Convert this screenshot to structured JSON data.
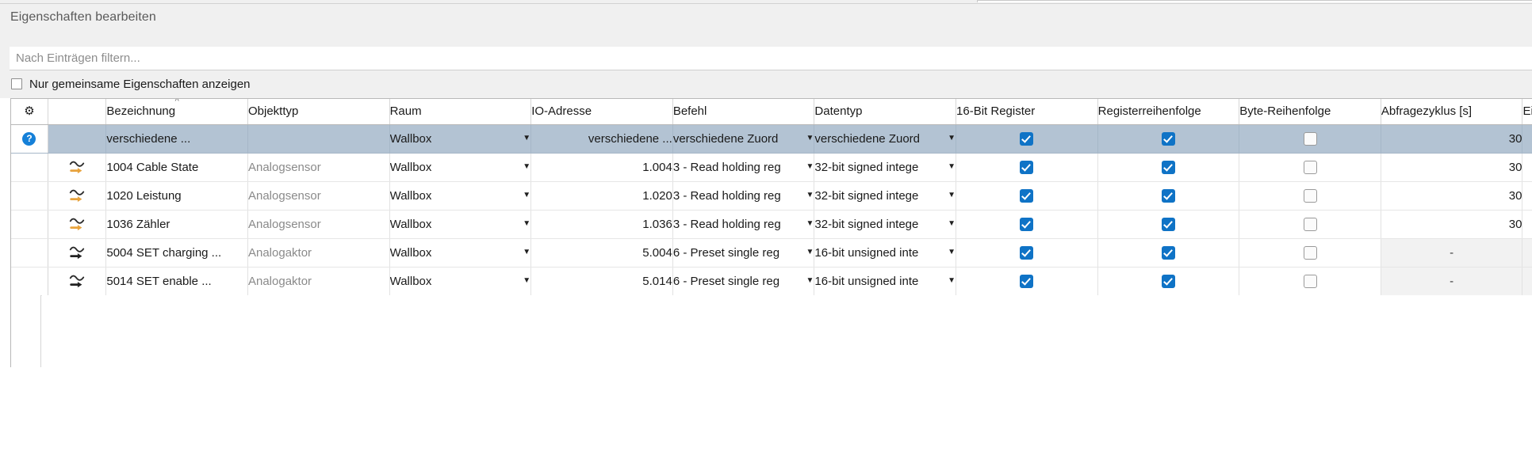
{
  "dialog": {
    "title": "Eigenschaften bearbeiten"
  },
  "filter": {
    "placeholder": "Nach Einträgen filtern...",
    "value": ""
  },
  "options": {
    "common_properties_label": "Nur gemeinsame Eigenschaften anzeigen",
    "common_properties_checked": false
  },
  "table": {
    "settings_icon": "gear-icon",
    "sort_column": "Bezeichnung",
    "sort_direction": "ascending",
    "columns": [
      {
        "key": "settings",
        "label": "",
        "icon": "gear-icon"
      },
      {
        "key": "typeicon",
        "label": ""
      },
      {
        "key": "bezeichnung",
        "label": "Bezeichnung"
      },
      {
        "key": "objekttyp",
        "label": "Objekttyp"
      },
      {
        "key": "raum",
        "label": "Raum"
      },
      {
        "key": "ioadresse",
        "label": "IO-Adresse"
      },
      {
        "key": "befehl",
        "label": "Befehl"
      },
      {
        "key": "datentyp",
        "label": "Datentyp"
      },
      {
        "key": "reg16",
        "label": "16-Bit Register"
      },
      {
        "key": "regorder",
        "label": "Registerreihenfolge"
      },
      {
        "key": "byteorder",
        "label": "Byte-Reihenfolge"
      },
      {
        "key": "abfrage",
        "label": "Abfragezyklus [s]"
      },
      {
        "key": "einheit",
        "label": "Ei"
      }
    ],
    "rows": [
      {
        "selected": true,
        "first_icon": "help-icon",
        "type_icon": "",
        "bezeichnung": "verschiedene ...",
        "objekttyp": "",
        "raum": "Wallbox",
        "ioadresse": "verschiedene ...",
        "befehl": "verschiedene Zuord",
        "datentyp": "verschiedene Zuord",
        "reg16": true,
        "regorder": true,
        "byteorder": false,
        "abfrage": "30",
        "abfrage_disabled": false
      },
      {
        "selected": false,
        "first_icon": "",
        "type_icon": "analog-sensor-icon",
        "bezeichnung": "1004 Cable State",
        "objekttyp": "Analogsensor",
        "raum": "Wallbox",
        "ioadresse": "1.004",
        "befehl": "3 - Read holding reg",
        "datentyp": "32-bit signed intege",
        "reg16": true,
        "regorder": true,
        "byteorder": false,
        "abfrage": "30",
        "abfrage_disabled": false
      },
      {
        "selected": false,
        "first_icon": "",
        "type_icon": "analog-sensor-icon",
        "bezeichnung": "1020 Leistung",
        "objekttyp": "Analogsensor",
        "raum": "Wallbox",
        "ioadresse": "1.020",
        "befehl": "3 - Read holding reg",
        "datentyp": "32-bit signed intege",
        "reg16": true,
        "regorder": true,
        "byteorder": false,
        "abfrage": "30",
        "abfrage_disabled": false
      },
      {
        "selected": false,
        "first_icon": "",
        "type_icon": "analog-sensor-icon",
        "bezeichnung": "1036 Zähler",
        "objekttyp": "Analogsensor",
        "raum": "Wallbox",
        "ioadresse": "1.036",
        "befehl": "3 - Read holding reg",
        "datentyp": "32-bit signed intege",
        "reg16": true,
        "regorder": true,
        "byteorder": false,
        "abfrage": "30",
        "abfrage_disabled": false
      },
      {
        "selected": false,
        "first_icon": "",
        "type_icon": "analog-actuator-icon",
        "bezeichnung": "5004 SET charging ...",
        "objekttyp": "Analogaktor",
        "raum": "Wallbox",
        "ioadresse": "5.004",
        "befehl": "6 - Preset single reg",
        "datentyp": "16-bit unsigned inte",
        "reg16": true,
        "regorder": true,
        "byteorder": false,
        "abfrage": "-",
        "abfrage_disabled": true
      },
      {
        "selected": false,
        "first_icon": "",
        "type_icon": "analog-actuator-icon",
        "bezeichnung": "5014 SET enable ...",
        "objekttyp": "Analogaktor",
        "raum": "Wallbox",
        "ioadresse": "5.014",
        "befehl": "6 - Preset single reg",
        "datentyp": "16-bit unsigned inte",
        "reg16": true,
        "regorder": true,
        "byteorder": false,
        "abfrage": "-",
        "abfrage_disabled": true
      }
    ]
  },
  "colors": {
    "selection": "#b3c3d3",
    "checkbox_checked": "#0f73c6",
    "help_icon": "#1580d8",
    "sensor_arrow": "#e8a33d",
    "actuator_arrow": "#222222",
    "dialog_bg": "#f0f0f0",
    "muted_text": "#8a8a8a"
  }
}
